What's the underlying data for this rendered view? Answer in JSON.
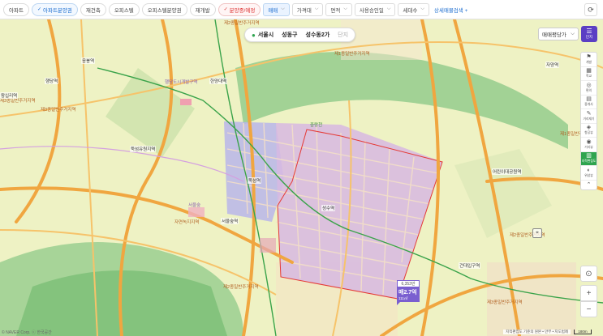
{
  "filters": {
    "chips": [
      {
        "label": "아파트",
        "state": "normal"
      },
      {
        "label": "아파트분양권",
        "state": "selected"
      },
      {
        "label": "재건축",
        "state": "normal"
      },
      {
        "label": "오피스텔",
        "state": "normal"
      },
      {
        "label": "오피스텔분양권",
        "state": "normal"
      },
      {
        "label": "재개발",
        "state": "normal"
      },
      {
        "label": "분양중/예정",
        "state": "selected-red"
      }
    ],
    "dropdowns": [
      {
        "label": "매매",
        "active": true
      },
      {
        "label": "가격대",
        "active": false
      },
      {
        "label": "면적",
        "active": false
      },
      {
        "label": "사용승인일",
        "active": false
      },
      {
        "label": "세대수",
        "active": false
      }
    ],
    "detail_search": "상세매물검색",
    "detail_plus": "+",
    "check_mark": "✓",
    "chevron": "⌵",
    "refresh_icon": "⟳"
  },
  "breadcrumb": {
    "city": "서울시",
    "district": "성동구",
    "dong": "성수동2가",
    "complex": "단지"
  },
  "sort": {
    "label": "매매평당가",
    "chevron": "⌵"
  },
  "list_button": {
    "label": "단지"
  },
  "tools": [
    {
      "icon": "⚑",
      "label": "개발"
    },
    {
      "icon": "▦",
      "label": "학교"
    },
    {
      "icon": "◎",
      "label": "편의"
    },
    {
      "icon": "▤",
      "label": "중개사"
    },
    {
      "icon": "✎",
      "label": "거리재기"
    },
    {
      "icon": "◈",
      "label": "항공뷰"
    },
    {
      "icon": "◉",
      "label": "거리뷰"
    },
    {
      "icon": "▥",
      "label": "지적편집도"
    },
    {
      "icon": "◐",
      "label": "위성뷰"
    },
    {
      "icon": "⌃",
      "label": ""
    }
  ],
  "controls": {
    "locate": "⊙",
    "zoom_in": "+",
    "zoom_out": "−"
  },
  "map_labels": [
    {
      "text": "제2종일반주거지역",
      "kind": "zone"
    },
    {
      "text": "제1종일반주거지역",
      "kind": "zone"
    },
    {
      "text": "제3종일반주거지역",
      "kind": "zone"
    },
    {
      "text": "제1종일반주거지역",
      "kind": "zone"
    },
    {
      "text": "제2종일반주거지역",
      "kind": "zone"
    },
    {
      "text": "제3종일반주거지역",
      "kind": "zone"
    },
    {
      "text": "제3종일반주거지역",
      "kind": "zone"
    },
    {
      "text": "제2종일반주거지역",
      "kind": "zone"
    },
    {
      "text": "자연녹지지역",
      "kind": "zone"
    },
    {
      "text": "응봉역",
      "kind": "sta"
    },
    {
      "text": "행당역",
      "kind": "sta"
    },
    {
      "text": "왕십리역",
      "kind": "sta"
    },
    {
      "text": "한양대역",
      "kind": "sta"
    },
    {
      "text": "뚝섬역",
      "kind": "sta"
    },
    {
      "text": "성수역",
      "kind": "sta"
    },
    {
      "text": "서울숲역",
      "kind": "sta"
    },
    {
      "text": "건대입구역",
      "kind": "sta"
    },
    {
      "text": "어린이대공원역",
      "kind": "sta"
    },
    {
      "text": "뚝섬유원지역",
      "kind": "sta"
    },
    {
      "text": "서울숲",
      "kind": "place"
    },
    {
      "text": "행당도시개발구역",
      "kind": "place"
    },
    {
      "text": "중랑천",
      "kind": "place"
    },
    {
      "text": "자양역",
      "kind": "sta"
    }
  ],
  "marker": {
    "top": "6,353만",
    "price": "매2.7억",
    "area": "111㎡"
  },
  "footer": {
    "copyright": "© NAVER Corp.",
    "credit": "ⓒ 한국공간",
    "legend": "지적편집도 기준의 원본 • 만부 • 지도범례",
    "scale": "180m"
  },
  "colors": {
    "accent": "#2ea44f",
    "brand_purple": "#5b3fc4",
    "marker": "#7a5fd0",
    "boundary": "#e53935"
  }
}
